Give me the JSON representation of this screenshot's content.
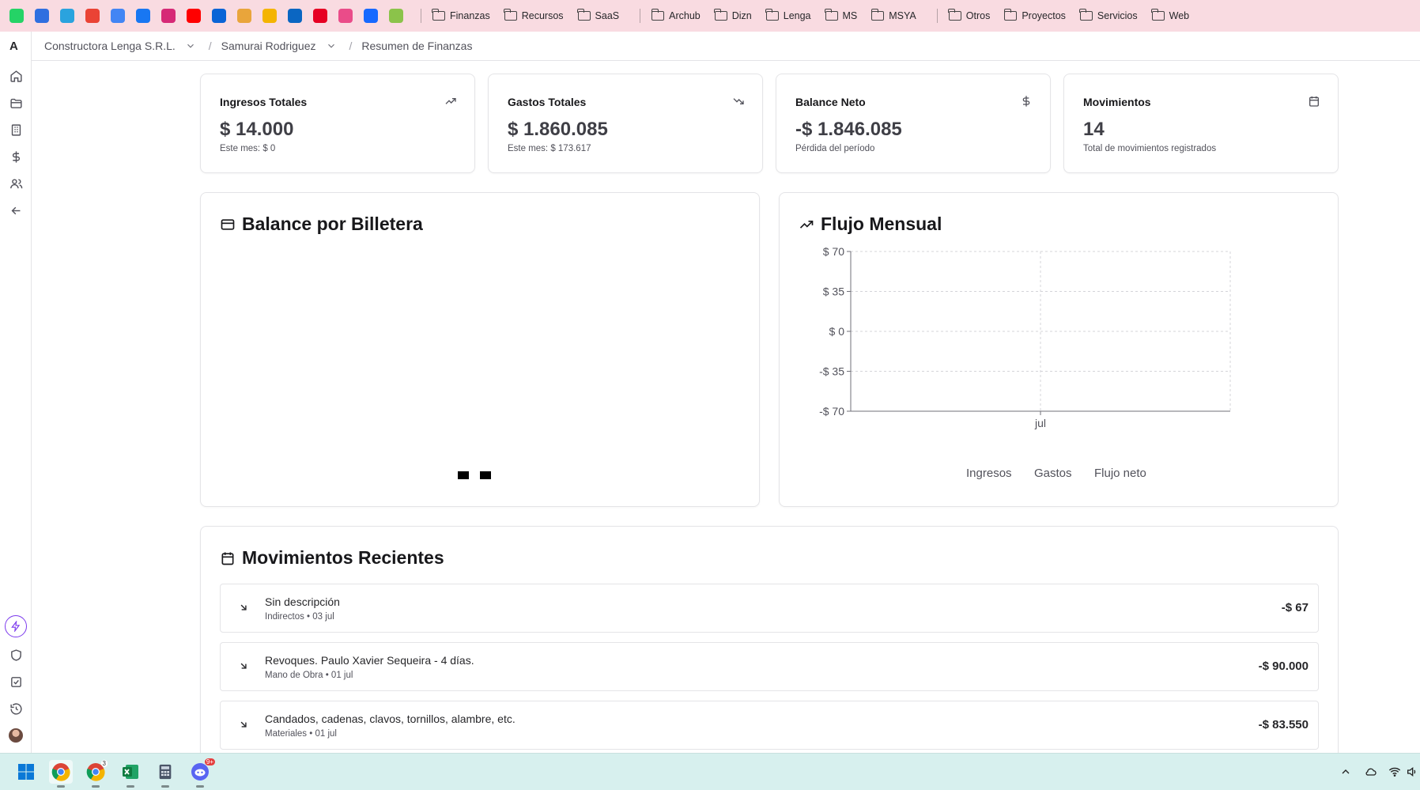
{
  "bookmarks": {
    "favicons": [
      {
        "name": "whatsapp-icon",
        "color": "#25d366"
      },
      {
        "name": "todo-check-icon",
        "color": "#2f6fe0"
      },
      {
        "name": "telegram-icon",
        "color": "#2aa3de"
      },
      {
        "name": "google-icon",
        "color": "#ea4335"
      },
      {
        "name": "google-calendar-icon",
        "color": "#4285f4"
      },
      {
        "name": "facebook-icon",
        "color": "#1877f2"
      },
      {
        "name": "instagram-icon",
        "color": "#d62976"
      },
      {
        "name": "youtube-icon",
        "color": "#ff0000"
      },
      {
        "name": "onedrive-icon",
        "color": "#0a64d6"
      },
      {
        "name": "tasks-list-icon",
        "color": "#e9a53b"
      },
      {
        "name": "google-drive-icon",
        "color": "#f4b400"
      },
      {
        "name": "linkedin-icon",
        "color": "#0a66c2"
      },
      {
        "name": "pinterest-icon",
        "color": "#e60023"
      },
      {
        "name": "dribbble-icon",
        "color": "#ea4c89"
      },
      {
        "name": "behance-icon",
        "color": "#1769ff"
      },
      {
        "name": "ring-icon",
        "color": "#8bc34a"
      }
    ],
    "group1": [
      "Finanzas",
      "Recursos",
      "SaaS"
    ],
    "group2": [
      "Archub",
      "Dizn",
      "Lenga",
      "MS",
      "MSYA"
    ],
    "group3": [
      "Otros",
      "Proyectos",
      "Servicios",
      "Web"
    ]
  },
  "rail": {
    "logo": "A"
  },
  "breadcrumb": {
    "org": "Constructora Lenga S.R.L.",
    "project": "Samurai Rodriguez",
    "page": "Resumen de Finanzas"
  },
  "stats": [
    {
      "title": "Ingresos Totales",
      "icon": "trending-up-icon",
      "value": "$ 14.000",
      "sub": "Este mes: $ 0"
    },
    {
      "title": "Gastos Totales",
      "icon": "trending-down-icon",
      "value": "$ 1.860.085",
      "sub": "Este mes: $ 173.617"
    },
    {
      "title": "Balance Neto",
      "icon": "dollar-icon",
      "value": "-$ 1.846.085",
      "sub": "Pérdida del período"
    },
    {
      "title": "Movimientos",
      "icon": "calendar-icon",
      "value": "14",
      "sub": "Total de movimientos registrados"
    }
  ],
  "wallet_panel": {
    "title": "Balance por Billetera"
  },
  "flow_panel": {
    "title": "Flujo Mensual"
  },
  "chart_data": {
    "type": "line",
    "title": "Flujo Mensual",
    "categories": [
      "jul"
    ],
    "y_ticks": [
      "$ 70",
      "$ 35",
      "$ 0",
      "-$ 35",
      "-$ 70"
    ],
    "ylim": [
      -70,
      70
    ],
    "series": [
      {
        "name": "Ingresos",
        "values": []
      },
      {
        "name": "Gastos",
        "values": []
      },
      {
        "name": "Flujo neto",
        "values": []
      }
    ],
    "grid": true,
    "legend": "bottom"
  },
  "movements_panel": {
    "title": "Movimientos Recientes",
    "items": [
      {
        "title": "Sin descripción",
        "sub": "Indirectos • 03 jul",
        "amount": "-$ 67"
      },
      {
        "title": "Revoques. Paulo Xavier Sequeira - 4 días.",
        "sub": "Mano de Obra • 01 jul",
        "amount": "-$ 90.000"
      },
      {
        "title": "Candados, cadenas, clavos, tornillos, alambre, etc.",
        "sub": "Materiales • 01 jul",
        "amount": "-$ 83.550"
      }
    ]
  },
  "taskbar": {
    "discord_badge": "9+",
    "chrome_badge": "3"
  }
}
